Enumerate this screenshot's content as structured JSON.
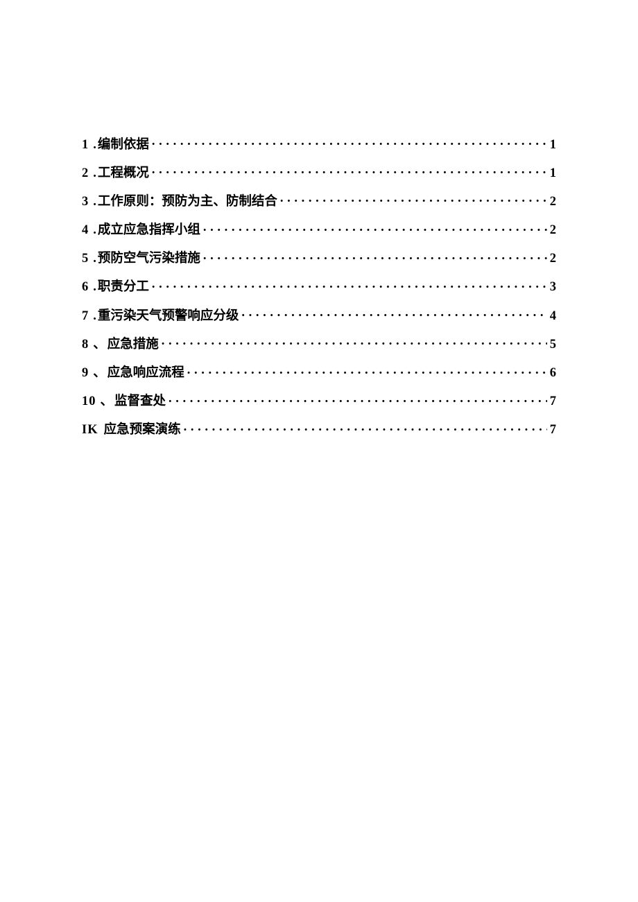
{
  "toc": [
    {
      "num": "1",
      "sep": ".",
      "title": "编制依据",
      "page": "1"
    },
    {
      "num": "2",
      "sep": ".",
      "title": "工程概况",
      "page": "1"
    },
    {
      "num": "3",
      "sep": ".",
      "title": "工作原则：预防为主、防制结合",
      "page": "2"
    },
    {
      "num": "4",
      "sep": ".",
      "title": "成立应急指挥小组",
      "page": "2"
    },
    {
      "num": "5",
      "sep": ".",
      "title": "预防空气污染措施",
      "page": "2"
    },
    {
      "num": "6",
      "sep": ".",
      "title": "职责分工",
      "page": "3"
    },
    {
      "num": "7",
      "sep": ".",
      "title": "重污染天气预警响应分级",
      "page": "4"
    },
    {
      "num": "8",
      "sep": "、",
      "title": "应急措施",
      "page": "5"
    },
    {
      "num": "9",
      "sep": "、",
      "title": "应急响应流程",
      "page": "6"
    },
    {
      "num": "10",
      "sep": "、",
      "title": "监督查处",
      "page": "7"
    },
    {
      "num": "IK",
      "sep": "",
      "title": "应急预案演练",
      "page": "7"
    }
  ]
}
